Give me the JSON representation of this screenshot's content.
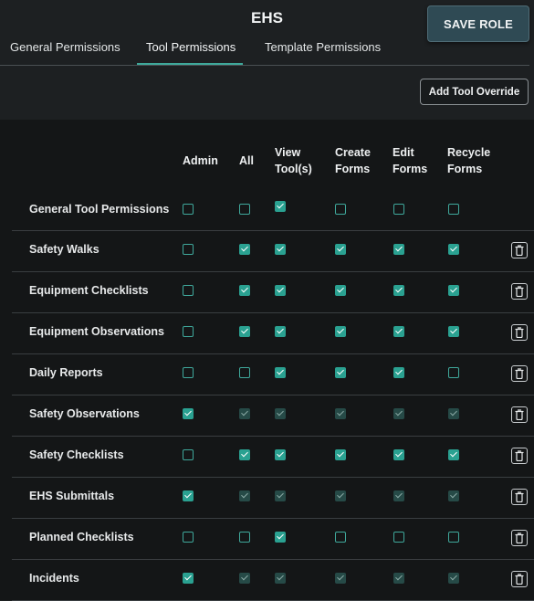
{
  "header": {
    "title": "EHS",
    "save_label": "SAVE ROLE"
  },
  "tabs": [
    {
      "label": "General Permissions",
      "active": false
    },
    {
      "label": "Tool Permissions",
      "active": true
    },
    {
      "label": "Template Permissions",
      "active": false
    }
  ],
  "add_override_label": "Add Tool Override",
  "columns": [
    {
      "line1": "Admin",
      "line2": ""
    },
    {
      "line1": "All",
      "line2": ""
    },
    {
      "line1": "View",
      "line2": "Tool(s)"
    },
    {
      "line1": "Create",
      "line2": "Forms"
    },
    {
      "line1": "Edit",
      "line2": "Forms"
    },
    {
      "line1": "Recycle",
      "line2": "Forms"
    }
  ],
  "rows": [
    {
      "label": "General Tool Permissions",
      "states": [
        "off",
        "off",
        "on",
        "off",
        "off",
        "off"
      ],
      "deletable": false
    },
    {
      "label": "Safety Walks",
      "states": [
        "off",
        "on",
        "on",
        "on",
        "on",
        "on"
      ],
      "deletable": true
    },
    {
      "label": "Equipment Checklists",
      "states": [
        "off",
        "on",
        "on",
        "on",
        "on",
        "on"
      ],
      "deletable": true
    },
    {
      "label": "Equipment Observations",
      "states": [
        "off",
        "on",
        "on",
        "on",
        "on",
        "on"
      ],
      "deletable": true
    },
    {
      "label": "Daily Reports",
      "states": [
        "off",
        "off",
        "on",
        "on",
        "on",
        "off"
      ],
      "deletable": true
    },
    {
      "label": "Safety Observations",
      "states": [
        "on",
        "dis",
        "dis",
        "dis",
        "dis",
        "dis"
      ],
      "deletable": true
    },
    {
      "label": "Safety Checklists",
      "states": [
        "off",
        "on",
        "on",
        "on",
        "on",
        "on"
      ],
      "deletable": true
    },
    {
      "label": "EHS Submittals",
      "states": [
        "on",
        "dis",
        "dis",
        "dis",
        "dis",
        "dis"
      ],
      "deletable": true
    },
    {
      "label": "Planned Checklists",
      "states": [
        "off",
        "off",
        "on",
        "off",
        "off",
        "off"
      ],
      "deletable": true
    },
    {
      "label": "Incidents",
      "states": [
        "on",
        "dis",
        "dis",
        "dis",
        "dis",
        "dis"
      ],
      "deletable": true
    }
  ],
  "colors": {
    "accent": "#3fa89b",
    "checked": "#2aa191",
    "disabled_checked": "#264a47",
    "background": "#1d2022",
    "panel": "#141617"
  },
  "icons": {
    "delete": "trash-icon"
  }
}
